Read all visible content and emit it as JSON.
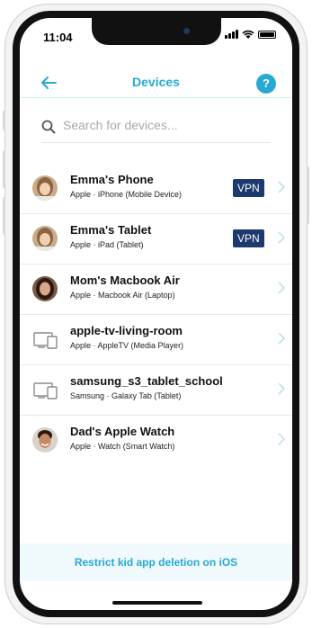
{
  "status_bar": {
    "time": "11:04"
  },
  "header": {
    "title": "Devices",
    "help_label": "?"
  },
  "search": {
    "placeholder": "Search for devices..."
  },
  "devices": [
    {
      "name": "Emma's Phone",
      "subtitle": "Apple · iPhone (Mobile Device)",
      "vpn": "VPN",
      "icon": "avatar-girl"
    },
    {
      "name": "Emma's Tablet",
      "subtitle": "Apple · iPad (Tablet)",
      "vpn": "VPN",
      "icon": "avatar-girl"
    },
    {
      "name": "Mom's Macbook Air",
      "subtitle": "Apple · Macbook Air (Laptop)",
      "vpn": "",
      "icon": "avatar-woman"
    },
    {
      "name": "apple-tv-living-room",
      "subtitle": "Apple · AppleTV (Media Player)",
      "vpn": "",
      "icon": "device-icon"
    },
    {
      "name": "samsung_s3_tablet_school",
      "subtitle": "Samsung · Galaxy Tab (Tablet)",
      "vpn": "",
      "icon": "device-icon"
    },
    {
      "name": "Dad's Apple Watch",
      "subtitle": "Apple · Watch (Smart Watch)",
      "vpn": "",
      "icon": "avatar-man"
    }
  ],
  "footer": {
    "banner_text": "Restrict kid app deletion on iOS"
  },
  "colors": {
    "accent": "#27a9d4",
    "vpn_badge": "#1d3a6e"
  }
}
